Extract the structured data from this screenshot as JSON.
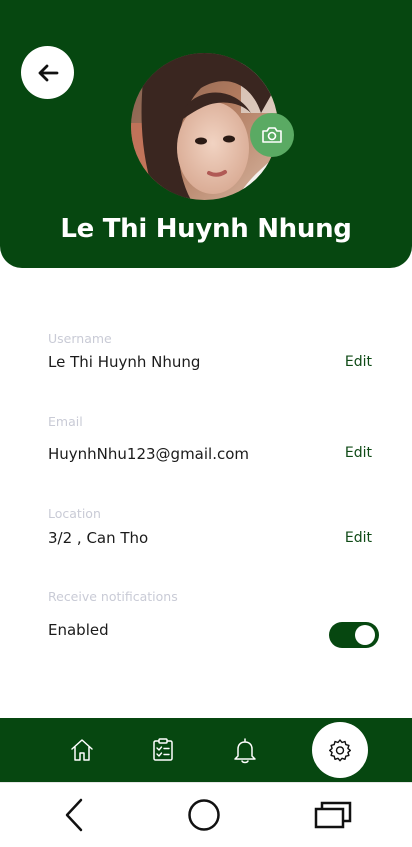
{
  "profile": {
    "name": "Le Thi Huynh Nhung"
  },
  "fields": {
    "username": {
      "label": "Username",
      "value": "Le Thi Huynh Nhung",
      "edit": "Edit"
    },
    "email": {
      "label": "Email",
      "value": "HuynhNhu123@gmail.com",
      "edit": "Edit"
    },
    "location": {
      "label": "Location",
      "value": "3/2 , Can Tho",
      "edit": "Edit"
    },
    "notifications": {
      "label": "Receive notifications",
      "value": "Enabled",
      "enabled": true
    }
  },
  "nav": {
    "items": [
      {
        "icon": "home-icon"
      },
      {
        "icon": "clipboard-icon"
      },
      {
        "icon": "bell-icon"
      },
      {
        "icon": "gear-icon",
        "active": true
      }
    ]
  },
  "system_nav": {
    "items": [
      {
        "icon": "back-chevron-icon"
      },
      {
        "icon": "home-circle-icon"
      },
      {
        "icon": "recents-icon"
      }
    ]
  },
  "colors": {
    "primary": "#064710",
    "camera_button": "#5aaa63",
    "label": "#c9cbd6"
  }
}
